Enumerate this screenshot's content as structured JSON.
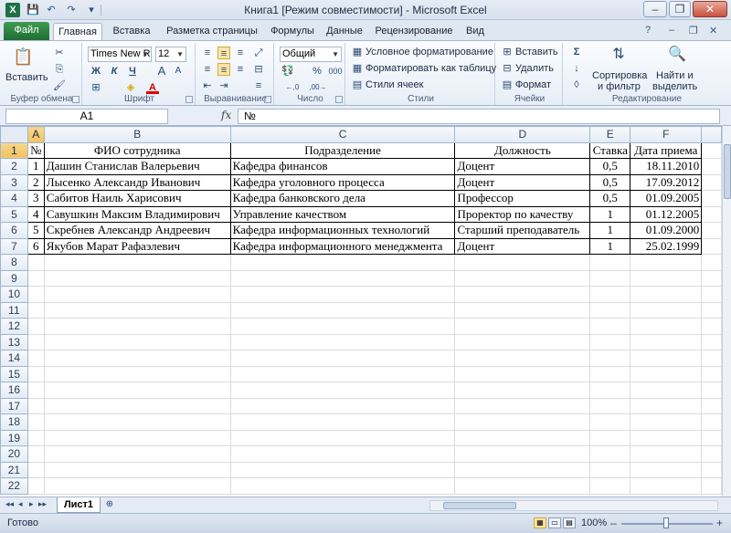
{
  "window": {
    "title": "Книга1  [Режим совместимости] - Microsoft Excel",
    "app_icon": "X",
    "qat": {
      "save_icon": "💾",
      "undo_icon": "↶",
      "redo_icon": "↷",
      "more_icon": "▾"
    },
    "controls": {
      "minimize": "–",
      "restore": "❐",
      "close": "✕"
    }
  },
  "ribbon_tabs": {
    "file": "Файл",
    "tabs": [
      "Главная",
      "Вставка",
      "Разметка страницы",
      "Формулы",
      "Данные",
      "Рецензирование",
      "Вид"
    ],
    "active_index": 0,
    "right_icons": {
      "help": "?",
      "min": "–",
      "restore": "❐",
      "close": "✕"
    }
  },
  "ribbon": {
    "clipboard": {
      "paste": "Вставить",
      "label": "Буфер обмена",
      "cut_icon": "✂",
      "copy_icon": "⎘",
      "format_painter_icon": "🖌"
    },
    "font": {
      "name": "Times New Roi",
      "size": "12",
      "bold": "Ж",
      "italic": "К",
      "underline": "Ч",
      "grow": "A",
      "shrink": "A",
      "borders_icon": "⊞",
      "fill_icon": "◈",
      "color_icon": "A",
      "label": "Шрифт"
    },
    "alignment": {
      "label": "Выравнивание",
      "wrap_icon": "≡",
      "merge_icon": "⊟"
    },
    "number": {
      "format": "Общий",
      "currency": "💱",
      "percent": "%",
      "thousands": "000",
      "inc_dec": "←,0",
      "dec_dec": ",00→",
      "label": "Число"
    },
    "styles": {
      "conditional": "Условное форматирование",
      "as_table": "Форматировать как таблицу",
      "cell_styles": "Стили ячеек",
      "label": "Стили"
    },
    "cells": {
      "insert": "Вставить",
      "delete": "Удалить",
      "format": "Формат",
      "label": "Ячейки"
    },
    "editing": {
      "sum_icon": "Σ",
      "fill_icon": "↓",
      "clear_icon": "◊",
      "sort": "Сортировка\nи фильтр",
      "sort1": "Сортировка",
      "sort2": "и фильтр",
      "find1": "Найти и",
      "find2": "выделить",
      "label": "Редактирование"
    }
  },
  "formula_bar": {
    "name_box": "A1",
    "fx": "fx",
    "formula": "№"
  },
  "sheet": {
    "columns": [
      "A",
      "B",
      "C",
      "D",
      "E",
      "F"
    ],
    "selected_column": "A",
    "selected_row": 1,
    "header_row": [
      "№",
      "ФИО сотрудника",
      "Подразделение",
      "Должность",
      "Ставка",
      "Дата приема"
    ],
    "rows": [
      [
        "1",
        "Дашин Станислав Валерьевич",
        "Кафедра финансов",
        "Доцент",
        "0,5",
        "18.11.2010"
      ],
      [
        "2",
        "Лысенко Александр Иванович",
        "Кафедра уголовного процесса",
        "Доцент",
        "0,5",
        "17.09.2012"
      ],
      [
        "3",
        "Сабитов Наиль Харисович",
        "Кафедра банковского дела",
        "Профессор",
        "0,5",
        "01.09.2005"
      ],
      [
        "4",
        "Савушкин Максим Владимирович",
        "Управление качеством",
        "Проректор по качеству",
        "1",
        "01.12.2005"
      ],
      [
        "5",
        "Скребнев Александр Андреевич",
        "Кафедра информационных технологий",
        "Старший преподаватель",
        "1",
        "01.09.2000"
      ],
      [
        "6",
        "Якубов Марат Рафаэлевич",
        "Кафедра информационного менеджмента",
        "Доцент",
        "1",
        "25.02.1999"
      ]
    ],
    "row_numbers": [
      "1",
      "2",
      "3",
      "4",
      "5",
      "6",
      "7",
      "8",
      "9",
      "10",
      "11",
      "12",
      "13",
      "14",
      "15",
      "16",
      "17",
      "18",
      "19",
      "20",
      "21",
      "22"
    ]
  },
  "sheet_tabs": {
    "active": "Лист1",
    "new_sheet_icon": "⊕",
    "nav": [
      "◂◂",
      "◂",
      "▸",
      "▸▸"
    ]
  },
  "status_bar": {
    "text": "Готово",
    "zoom": "100%",
    "zoom_minus": "–",
    "zoom_plus": "+"
  }
}
